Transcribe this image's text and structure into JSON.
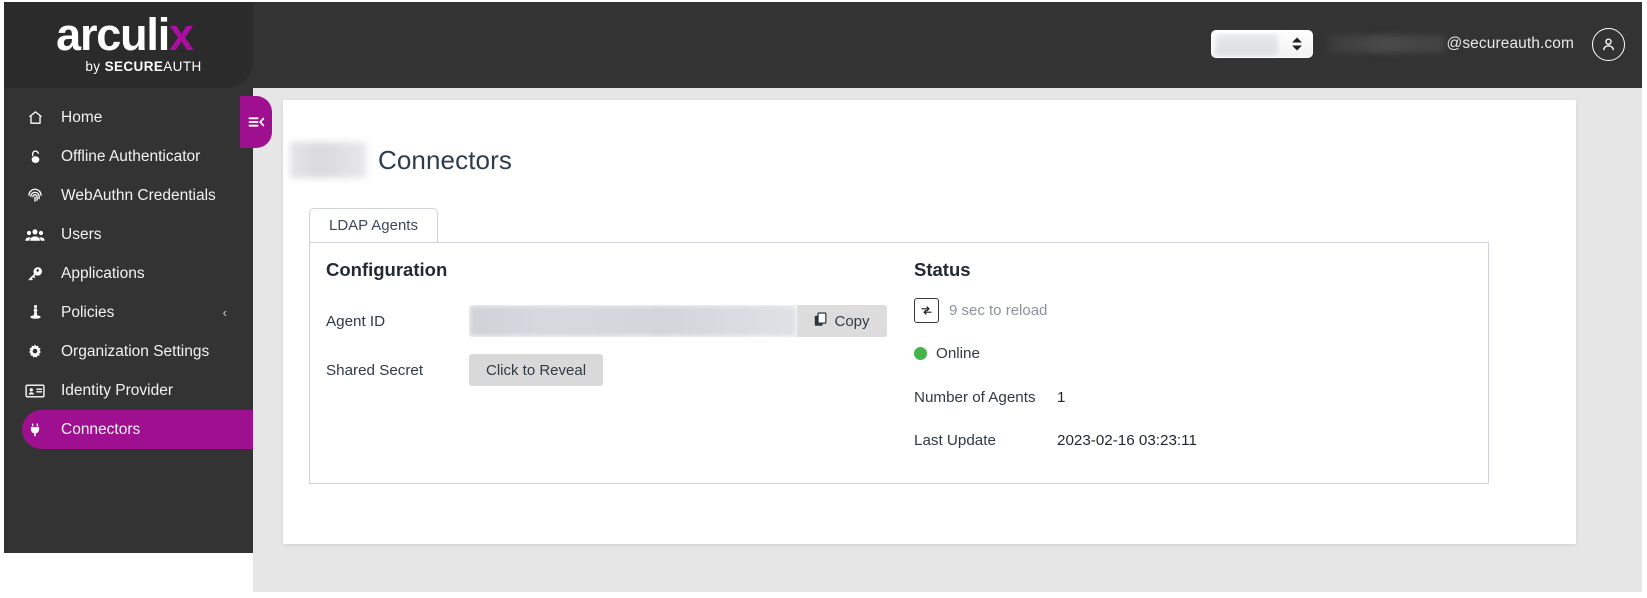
{
  "brand": {
    "logo_word": "arculi",
    "logo_accent_letter": "x",
    "logo_tagline_by": "by ",
    "logo_tagline_secure": "SECURE",
    "logo_tagline_auth": "AUTH",
    "accent_color": "#9e1090",
    "logo_accent_color": "#ab0ea1"
  },
  "topbar": {
    "org_select_value": "",
    "username_masked": "",
    "user_domain": "@secureauth.com",
    "avatar_icon": "user-avatar-icon",
    "background_color": "#333333"
  },
  "sidebar": {
    "collapse_toggle_icon": "collapse-sidebar-icon",
    "items": [
      {
        "label": "Home",
        "icon": "home-icon",
        "active": false,
        "has_caret": false
      },
      {
        "label": "Offline Authenticator",
        "icon": "padlock-icon",
        "active": false,
        "has_caret": false
      },
      {
        "label": "WebAuthn Credentials",
        "icon": "fingerprint-icon",
        "active": false,
        "has_caret": false
      },
      {
        "label": "Users",
        "icon": "users-icon",
        "active": false,
        "has_caret": false
      },
      {
        "label": "Applications",
        "icon": "key-icon",
        "active": false,
        "has_caret": false
      },
      {
        "label": "Policies",
        "icon": "policy-icon",
        "active": false,
        "has_caret": true,
        "caret": "‹"
      },
      {
        "label": "Organization Settings",
        "icon": "gear-icon",
        "active": false,
        "has_caret": false
      },
      {
        "label": "Identity Provider",
        "icon": "id-card-icon",
        "active": false,
        "has_caret": false
      },
      {
        "label": "Connectors",
        "icon": "plug-icon",
        "active": true,
        "has_caret": false
      }
    ]
  },
  "main": {
    "page_title": "Connectors",
    "page_title_prefix_masked": "",
    "tabs": [
      {
        "label": "LDAP Agents",
        "active": true
      }
    ],
    "configuration": {
      "section_title": "Configuration",
      "agent_id_label": "Agent ID",
      "agent_id_value_masked": "",
      "copy_label": "Copy",
      "copy_icon": "copy-icon",
      "shared_secret_label": "Shared Secret",
      "reveal_label": "Click to Reveal"
    },
    "status": {
      "section_title": "Status",
      "reload_icon": "refresh-icon",
      "reload_text": "9 sec to reload",
      "connection_state": "Online",
      "connection_color": "#44b34a",
      "rows": [
        {
          "label": "Number of Agents",
          "value": "1"
        },
        {
          "label": "Last Update",
          "value": "2023-02-16 03:23:11"
        }
      ]
    }
  }
}
